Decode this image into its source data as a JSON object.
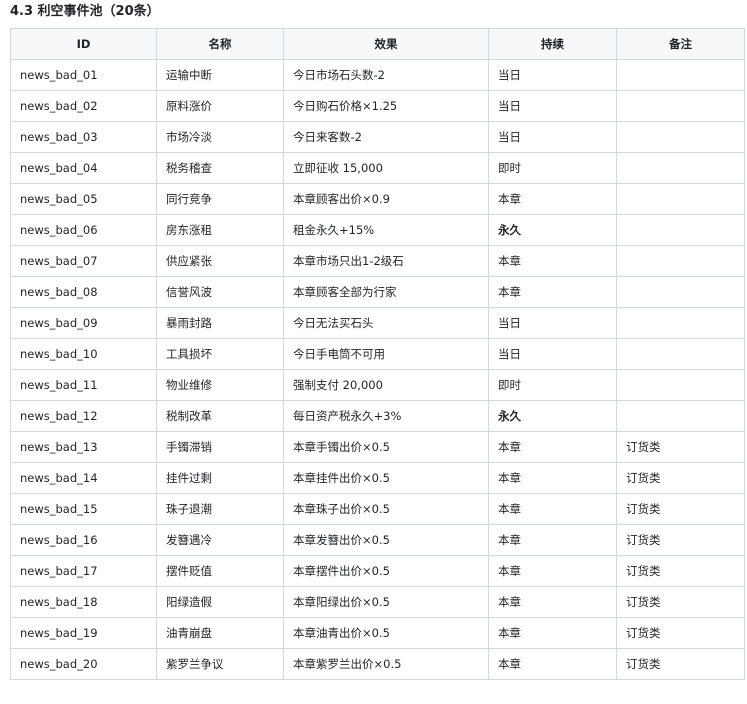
{
  "section_title": "4.3 利空事件池（20条）",
  "table": {
    "headers": {
      "id": "ID",
      "name": "名称",
      "effect": "效果",
      "duration": "持续",
      "note": "备注"
    },
    "rows": [
      {
        "id": "news_bad_01",
        "name": "运输中断",
        "effect": "今日市场石头数-2",
        "duration": "当日",
        "duration_bold": false,
        "note": ""
      },
      {
        "id": "news_bad_02",
        "name": "原料涨价",
        "effect": "今日购石价格×1.25",
        "duration": "当日",
        "duration_bold": false,
        "note": ""
      },
      {
        "id": "news_bad_03",
        "name": "市场冷淡",
        "effect": "今日来客数-2",
        "duration": "当日",
        "duration_bold": false,
        "note": ""
      },
      {
        "id": "news_bad_04",
        "name": "税务稽查",
        "effect": "立即征收 15,000",
        "duration": "即时",
        "duration_bold": false,
        "note": ""
      },
      {
        "id": "news_bad_05",
        "name": "同行竞争",
        "effect": "本章顾客出价×0.9",
        "duration": "本章",
        "duration_bold": false,
        "note": ""
      },
      {
        "id": "news_bad_06",
        "name": "房东涨租",
        "effect": "租金永久+15%",
        "duration": "永久",
        "duration_bold": true,
        "note": ""
      },
      {
        "id": "news_bad_07",
        "name": "供应紧张",
        "effect": "本章市场只出1-2级石",
        "duration": "本章",
        "duration_bold": false,
        "note": ""
      },
      {
        "id": "news_bad_08",
        "name": "信誉风波",
        "effect": "本章顾客全部为行家",
        "duration": "本章",
        "duration_bold": false,
        "note": ""
      },
      {
        "id": "news_bad_09",
        "name": "暴雨封路",
        "effect": "今日无法买石头",
        "duration": "当日",
        "duration_bold": false,
        "note": ""
      },
      {
        "id": "news_bad_10",
        "name": "工具损坏",
        "effect": "今日手电筒不可用",
        "duration": "当日",
        "duration_bold": false,
        "note": ""
      },
      {
        "id": "news_bad_11",
        "name": "物业维修",
        "effect": "强制支付 20,000",
        "duration": "即时",
        "duration_bold": false,
        "note": ""
      },
      {
        "id": "news_bad_12",
        "name": "税制改革",
        "effect": "每日资产税永久+3%",
        "duration": "永久",
        "duration_bold": true,
        "note": ""
      },
      {
        "id": "news_bad_13",
        "name": "手镯滞销",
        "effect": "本章手镯出价×0.5",
        "duration": "本章",
        "duration_bold": false,
        "note": "订货类"
      },
      {
        "id": "news_bad_14",
        "name": "挂件过剩",
        "effect": "本章挂件出价×0.5",
        "duration": "本章",
        "duration_bold": false,
        "note": "订货类"
      },
      {
        "id": "news_bad_15",
        "name": "珠子退潮",
        "effect": "本章珠子出价×0.5",
        "duration": "本章",
        "duration_bold": false,
        "note": "订货类"
      },
      {
        "id": "news_bad_16",
        "name": "发簪遇冷",
        "effect": "本章发簪出价×0.5",
        "duration": "本章",
        "duration_bold": false,
        "note": "订货类"
      },
      {
        "id": "news_bad_17",
        "name": "摆件贬值",
        "effect": "本章摆件出价×0.5",
        "duration": "本章",
        "duration_bold": false,
        "note": "订货类"
      },
      {
        "id": "news_bad_18",
        "name": "阳绿造假",
        "effect": "本章阳绿出价×0.5",
        "duration": "本章",
        "duration_bold": false,
        "note": "订货类"
      },
      {
        "id": "news_bad_19",
        "name": "油青崩盘",
        "effect": "本章油青出价×0.5",
        "duration": "本章",
        "duration_bold": false,
        "note": "订货类"
      },
      {
        "id": "news_bad_20",
        "name": "紫罗兰争议",
        "effect": "本章紫罗兰出价×0.5",
        "duration": "本章",
        "duration_bold": false,
        "note": "订货类"
      }
    ]
  },
  "colors": {
    "border": "#d1d9e0",
    "header_bg": "#f6f8fa",
    "text": "#1f2328"
  }
}
